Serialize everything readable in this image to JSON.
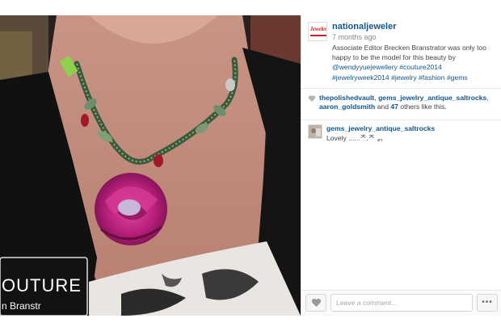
{
  "post": {
    "username": "nationaljeweler",
    "avatar_icon": "national-jeweler-logo",
    "avatar_logo_text": "Jeweler",
    "time_ago": "7 months ago",
    "caption": {
      "text_before": "Associate Editor Brecken Branstrator was only too happy to be the model for this beauty by ",
      "mention": "@wendyyuejewellery",
      "hashtags": "#couture2014 #jewelryweek2014 #jewelry #fashion #gems"
    }
  },
  "photo": {
    "badge_text": "OUTURE",
    "badge_subtext": "n Branstr"
  },
  "likes": {
    "icon": "heart-icon",
    "user1": "thepolishedvault",
    "sep1": ", ",
    "user2": "gems_jewelry_antique_saltrocks",
    "sep2": ", ",
    "user3": "aaron_goldsmith",
    "and_text": " and ",
    "others_count": "47",
    "others_suffix": " others like this."
  },
  "comments": [
    {
      "username": "gems_jewelry_antique_saltrocks",
      "text": "Lovely ......ᄌ.ᄌ ᆰ"
    }
  ],
  "footer": {
    "like_icon": "heart-icon",
    "comment_placeholder": "Leave a comment...",
    "more_label": "•••"
  },
  "colors": {
    "link": "#125688",
    "text": "#444444",
    "muted": "#888888",
    "brand_red": "#c1272d"
  }
}
